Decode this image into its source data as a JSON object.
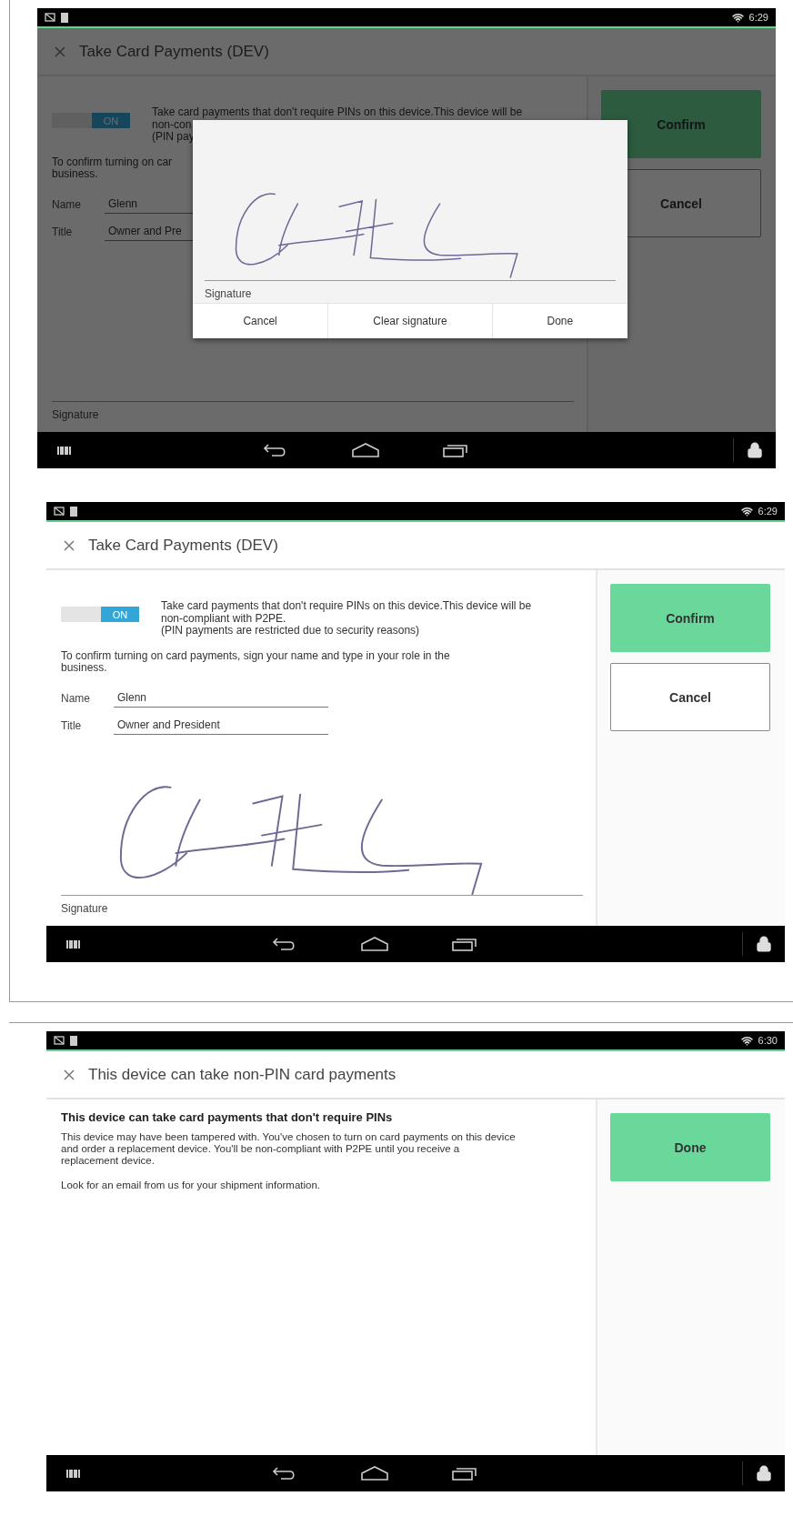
{
  "screens": [
    {
      "kind": "form",
      "status_bar": {
        "time": "6:29"
      },
      "header": {
        "title": "Take Card Payments (DEV)"
      },
      "toggle": {
        "label": "ON",
        "on": true
      },
      "description": [
        "Take card payments that don't require PINs on this device.This device will be",
        "non-con",
        "(PIN pay"
      ],
      "instruction": [
        "To confirm turning on car",
        "business."
      ],
      "fields": [
        {
          "label": "Name",
          "value": "Glenn"
        },
        {
          "label": "Title",
          "value": "Owner and Pre"
        }
      ],
      "signature": {
        "label": "Signature",
        "signed": false
      },
      "buttons": [
        {
          "label": "Confirm",
          "kind": "primary"
        },
        {
          "label": "Cancel",
          "kind": "secondary"
        }
      ],
      "dialog": {
        "signature_label": "Signature",
        "signed": true,
        "buttons": [
          "Cancel",
          "Clear signature",
          "Done"
        ]
      }
    },
    {
      "kind": "form",
      "status_bar": {
        "time": "6:29"
      },
      "header": {
        "title": "Take Card Payments (DEV)"
      },
      "toggle": {
        "label": "ON",
        "on": true
      },
      "description": [
        "Take card payments that don't require PINs on this device.This device will be",
        "non-compliant with P2PE.",
        "(PIN payments are restricted due to security reasons)"
      ],
      "instruction": [
        "To confirm turning on card payments, sign your name and type in your role in the",
        "business."
      ],
      "fields": [
        {
          "label": "Name",
          "value": "Glenn"
        },
        {
          "label": "Title",
          "value": "Owner and President"
        }
      ],
      "signature": {
        "label": "Signature",
        "signed": true
      },
      "buttons": [
        {
          "label": "Confirm",
          "kind": "primary"
        },
        {
          "label": "Cancel",
          "kind": "secondary"
        }
      ]
    },
    {
      "kind": "notice",
      "status_bar": {
        "time": "6:30"
      },
      "header": {
        "title": "This device can take non-PIN card payments"
      },
      "heading": "This device can take card payments that don't require PINs",
      "paragraphs": [
        "This device may have been tampered with. You've chosen to turn on card payments on this device and order a replacement device. You'll be non-compliant with P2PE until you receive a replacement device.",
        "Look for an email from us for your shipment information."
      ],
      "buttons": [
        {
          "label": "Done",
          "kind": "primary"
        }
      ]
    }
  ]
}
